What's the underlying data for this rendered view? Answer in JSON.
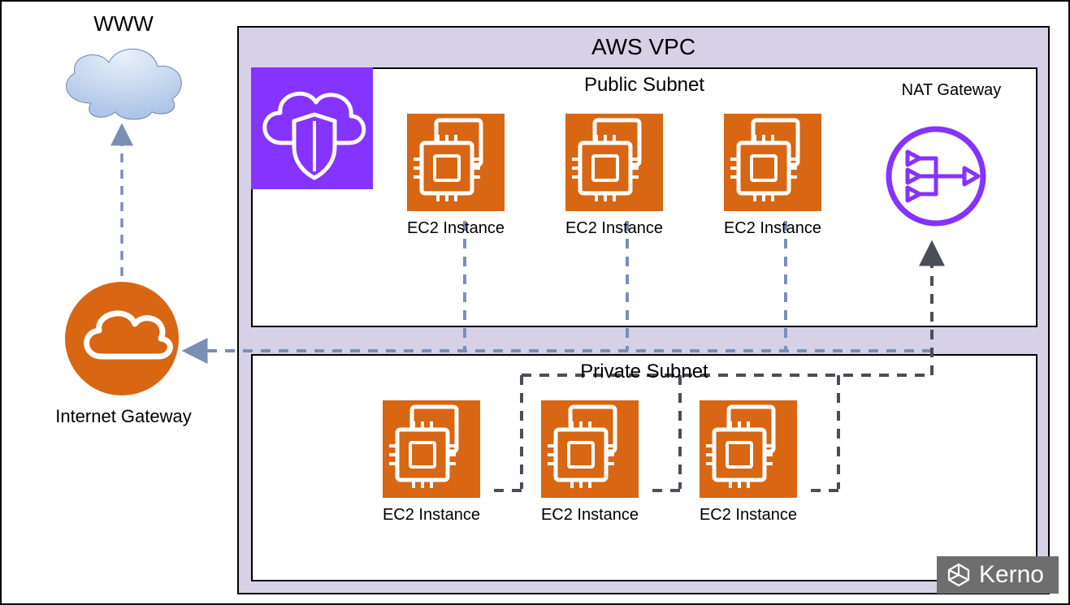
{
  "labels": {
    "www": "WWW",
    "vpc_title": "AWS VPC",
    "public_subnet": "Public Subnet",
    "private_subnet": "Private Subnet",
    "nat_gateway": "NAT Gateway",
    "internet_gateway": "Internet Gateway",
    "ec2": "EC2 Instance",
    "brand": "Kerno"
  },
  "colors": {
    "aws_orange": "#D86613",
    "aws_purple": "#8533FF",
    "vpc_bg": "#D7D1E8",
    "line_blue": "#7B8FB5",
    "line_dark": "#4A4E59",
    "brand_bg": "#6E6E6E"
  },
  "public_ec2_count": 3,
  "private_ec2_count": 3,
  "icons": {
    "cloud": "cloud-icon",
    "vpc": "vpc-shield-icon",
    "ec2": "ec2-chip-icon",
    "igw": "internet-gateway-icon",
    "nat": "nat-gateway-icon",
    "brand": "kerno-logo-icon"
  }
}
